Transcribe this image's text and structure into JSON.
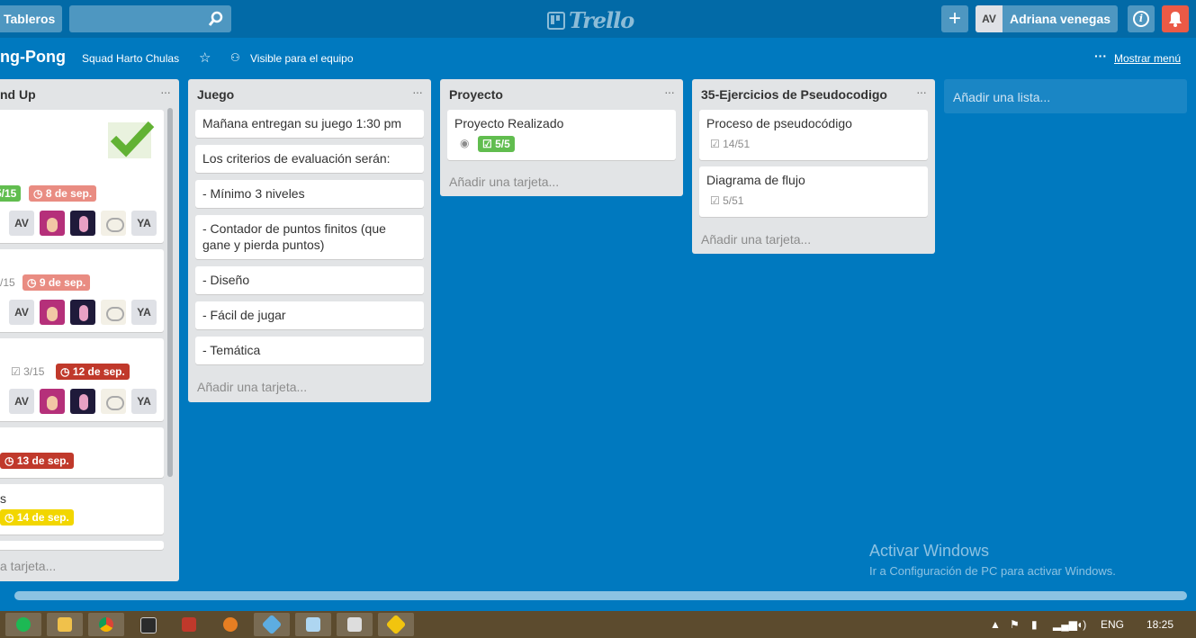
{
  "topbar": {
    "boards_label": "Tableros",
    "search_placeholder": "",
    "logo": "Trello",
    "user_initials": "AV",
    "user_name": "Adriana venegas"
  },
  "board": {
    "title": "ng-Pong",
    "team": "Squad Harto Chulas",
    "visibility": "Visible para el equipo",
    "menu_label": "Mostrar menú",
    "menu_dots": "···"
  },
  "lists": [
    {
      "title": "nd Up",
      "cards": [
        {
          "checklist": "5/15",
          "due": "8 de sep."
        },
        {
          "checklist": "/15",
          "due": "9 de sep."
        },
        {
          "checklist": "3/15",
          "due": "12 de sep."
        },
        {
          "due": "13 de sep."
        },
        {
          "text": "s",
          "due": "14 de sep."
        }
      ],
      "members": [
        "AV",
        "YA"
      ],
      "add_card": "a tarjeta..."
    },
    {
      "title": "Juego",
      "cards": [
        "Mañana entregan su juego 1:30 pm",
        "Los criterios de evaluación serán:",
        "- Mínimo 3 niveles",
        "- Contador de puntos finitos (que gane y pierda puntos)",
        "- Diseño",
        "- Fácil de jugar",
        "- Temática"
      ],
      "add_card": "Añadir una tarjeta..."
    },
    {
      "title": "Proyecto",
      "cards": [
        {
          "text": "Proyecto Realizado",
          "checklist": "5/5"
        }
      ],
      "add_card": "Añadir una tarjeta..."
    },
    {
      "title": "35-Ejercicios de Pseudocodigo",
      "cards": [
        {
          "text": "Proceso de pseudocódigo",
          "checklist": "14/51"
        },
        {
          "text": "Diagrama de flujo",
          "checklist": "5/51"
        }
      ],
      "add_card": "Añadir una tarjeta..."
    }
  ],
  "add_list": "Añadir una lista...",
  "watermark": {
    "line1": "Activar Windows",
    "line2": "Ir a Configuración de PC para activar Windows."
  },
  "taskbar": {
    "lang": "ENG",
    "time": "18:25"
  },
  "colors": {
    "board_bg": "#0079bf",
    "topbar": "#026aa7",
    "green_label": "#61bd4f",
    "red_label": "#eb5a46"
  }
}
